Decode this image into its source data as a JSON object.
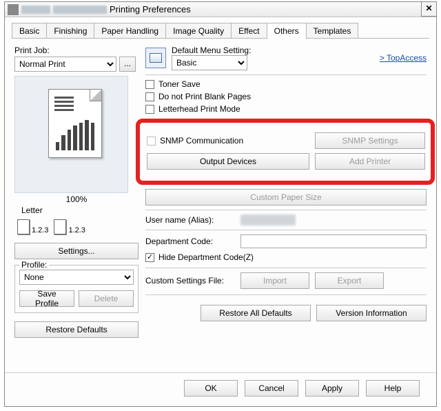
{
  "window": {
    "title_suffix": "Printing Preferences"
  },
  "tabs": [
    "Basic",
    "Finishing",
    "Paper Handling",
    "Image Quality",
    "Effect",
    "Others",
    "Templates"
  ],
  "active_tab": "Others",
  "left": {
    "print_job_label": "Print Job:",
    "print_job_value": "Normal Print",
    "zoom": "100%",
    "paper": "Letter",
    "copies_a": "1.2.3",
    "copies_b": "1.2.3",
    "settings_btn": "Settings...",
    "profile_legend": "Profile:",
    "profile_value": "None",
    "save_profile_btn": "Save Profile",
    "delete_btn": "Delete",
    "restore_btn": "Restore Defaults"
  },
  "right": {
    "default_menu_label": "Default Menu Setting:",
    "default_menu_value": "Basic",
    "topaccess": "> TopAccess",
    "toner_save": "Toner Save",
    "blank_pages": "Do not Print Blank Pages",
    "letterhead": "Letterhead Print Mode",
    "snmp_comm": "SNMP Communication",
    "snmp_settings_btn": "SNMP Settings",
    "output_devices_btn": "Output Devices",
    "add_printer_btn": "Add Printer",
    "custom_paper_btn": "Custom Paper Size",
    "user_name_label": "User name (Alias):",
    "dept_code_label": "Department Code:",
    "hide_dept": "Hide Department Code(Z)",
    "custom_settings_label": "Custom Settings File:",
    "import_btn": "Import",
    "export_btn": "Export",
    "restore_all_btn": "Restore All Defaults",
    "version_btn": "Version Information"
  },
  "footer": {
    "ok": "OK",
    "cancel": "Cancel",
    "apply": "Apply",
    "help": "Help"
  }
}
